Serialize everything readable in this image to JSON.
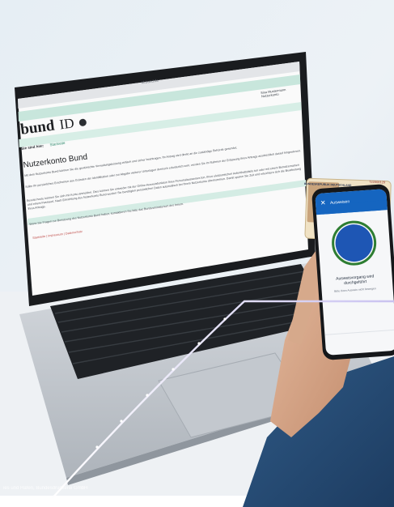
{
  "photo": {
    "copyright": "ies und Hafen, Bundesdruckerei GmbH"
  },
  "browser": {
    "address_bar": "id.bund.de",
    "user_name": "Sina Mustermann",
    "user_role": "Nutzerkonto"
  },
  "website": {
    "logo_text": "bund",
    "logo_suffix": "ID",
    "breadcrumb_label": "Sie sind hier:",
    "breadcrumb_current": "Startseite",
    "heading": "Nutzerkonto Bund",
    "paragraph_1": "Mit dem Nutzerkonto Bund können Sie die gewünschte Verwaltungsleistung einfach und sicher beantragen. Ihr Antrag wird direkt an die zuständige Behörde gesendet.",
    "paragraph_2": "Sollte Ihr persönliches Erscheinen aus Gründen der Identifikation oder zur Abgabe weiterer Unterlagen dennoch erforderlich sein, werden Sie im Rahmen der Erfassung Ihres Antrags ausdrücklich darauf hingewiesen.",
    "paragraph_3": "Bereits heute können Sie sich mit Konto anmelden. Dies können Sie entweder mit der Online-Ausweisfunktion Ihres Personalausweises tun, Ihres elektronischen Aufenthaltstitels tun oder mit einem Benutzernamen und einem Passwort. Nach Einrichtung des Nutzerkonto Bund werden Sie benötigten persönlichen Daten automatisch bei Ihrem Nutzerkonto übernommen. Damit sparen Sie Zeit und erleichtern sich die Bearbeitung Ihres Antrags.",
    "paragraph_4": "Wenn Sie Fragen zur Benutzung des Nutzerkonto Bund haben, kontaktieren Sie bitte das Bundesministerium des Innern.",
    "footer_links": "Startseite | Impressum | Datenschutz"
  },
  "id_card": {
    "header": "BUNDESREPUBLIK DEUTSCHLAND",
    "number": "T22000129"
  },
  "phone": {
    "app_title": "Ausweisen",
    "status_title": "Ausweisvorgang wird durchgeführt",
    "status_subtitle": "Bitte Ihren Ausweis nicht bewegen"
  },
  "colors": {
    "site_accent": "#c8e6dc",
    "app_blue": "#1565c0",
    "status_ring": "#2e7d32"
  }
}
